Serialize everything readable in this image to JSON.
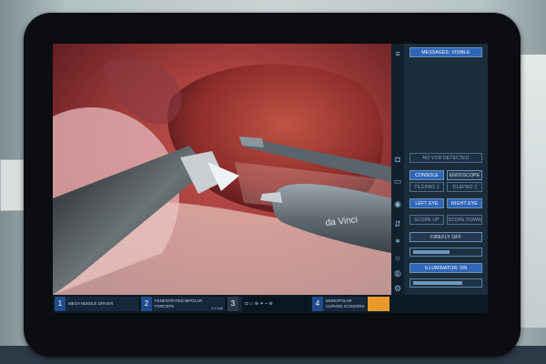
{
  "side_panel": {
    "messages_button": "MESSAGES: VISIBLE",
    "no_vor_detected": "NO VOR DETECTED",
    "console": "CONSOLE",
    "endoscope": "ENDOSCOPE",
    "tilepro1": "TILEPRO 1",
    "tilepro2": "TILEPRO 2",
    "left_eye": "LEFT EYE",
    "right_eye": "RIGHT EYE",
    "scope_up": "SCOPE UP",
    "scope_down": "SCOPE DOWN",
    "firefly": "FIREFLY OFF",
    "illuminator": "ILLUMINATOR: ON"
  },
  "bottom_bar": {
    "arm1": {
      "number": "1",
      "label": "MEGA NEEDLE DRIVER"
    },
    "arm2": {
      "number": "2",
      "label": "FENESTRATED BIPOLAR FORCEPS",
      "tag": "1.0 xx0"
    },
    "arm3": {
      "number": "3"
    },
    "arm4": {
      "number": "4",
      "label": "MONOPOLAR CURVED SCISSORS"
    }
  },
  "instrument_brand": "da Vinci"
}
